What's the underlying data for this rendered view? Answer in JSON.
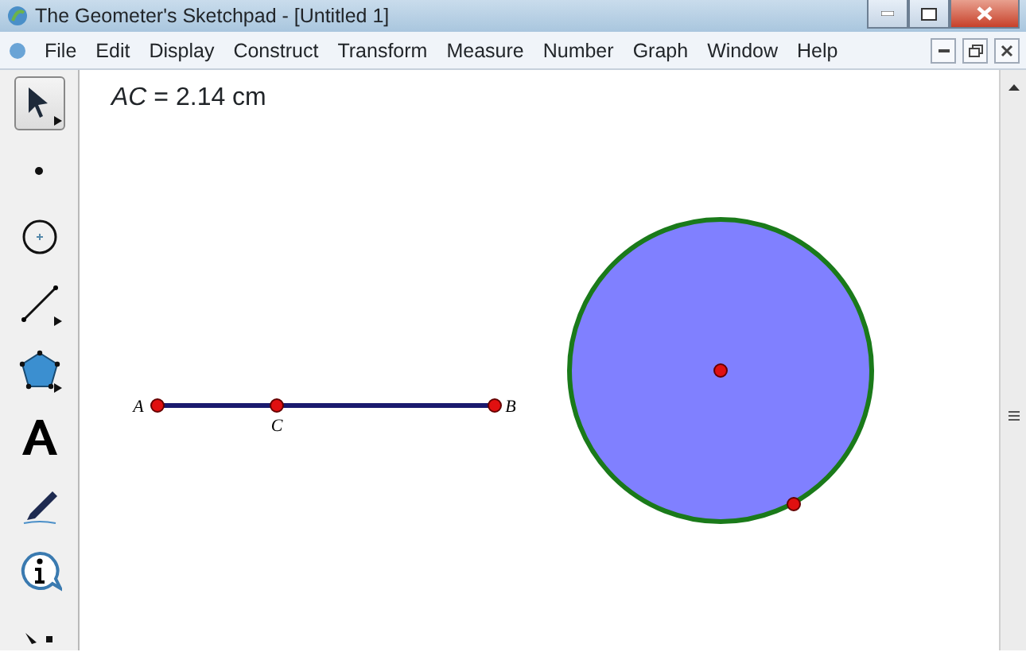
{
  "window": {
    "title": "The Geometer's Sketchpad - [Untitled 1]"
  },
  "menu": [
    "File",
    "Edit",
    "Display",
    "Construct",
    "Transform",
    "Measure",
    "Number",
    "Graph",
    "Window",
    "Help"
  ],
  "toolbox": [
    {
      "kind": "arrow",
      "selected": true,
      "submenu": true
    },
    {
      "kind": "point",
      "selected": false,
      "submenu": false
    },
    {
      "kind": "compass",
      "selected": false,
      "submenu": false
    },
    {
      "kind": "line",
      "selected": false,
      "submenu": true
    },
    {
      "kind": "polygon",
      "selected": false,
      "submenu": true
    },
    {
      "kind": "text",
      "selected": false,
      "submenu": false
    },
    {
      "kind": "marker",
      "selected": false,
      "submenu": false
    },
    {
      "kind": "info",
      "selected": false,
      "submenu": false
    },
    {
      "kind": "custom",
      "selected": false
    }
  ],
  "canvas": {
    "measurement": "*AC* = 2.14 cm",
    "points": [
      {
        "label": "A"
      },
      {
        "label": "C"
      },
      {
        "label": "B"
      }
    ]
  }
}
